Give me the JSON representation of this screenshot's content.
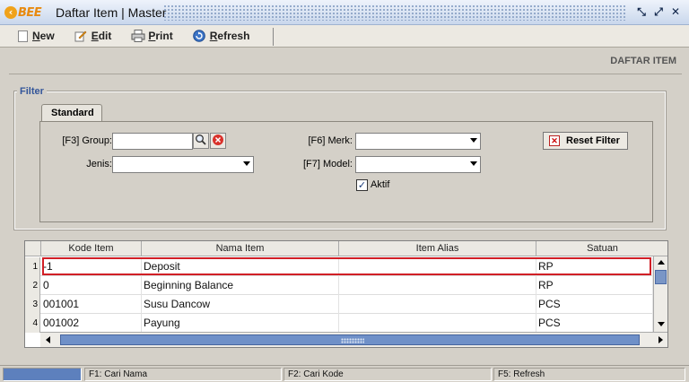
{
  "window": {
    "logo_text": "BEE",
    "title": "Daftar Item | Master"
  },
  "toolbar": {
    "new_label": "New",
    "edit_label": "Edit",
    "print_label": "Print",
    "refresh_label": "Refresh"
  },
  "page": {
    "section_title": "DAFTAR ITEM"
  },
  "filter": {
    "legend": "Filter",
    "tab_label": "Standard",
    "group_label": "[F3] Group:",
    "jenis_label": "Jenis:",
    "merk_label": "[F6] Merk:",
    "model_label": "[F7] Model:",
    "aktif_label": "Aktif",
    "aktif_checked": true,
    "reset_label": "Reset Filter",
    "group_value": "",
    "jenis_value": "",
    "merk_value": "",
    "model_value": ""
  },
  "grid": {
    "columns": [
      "Kode Item",
      "Nama Item",
      "Item Alias",
      "Satuan"
    ],
    "rows": [
      {
        "num": "1",
        "kode": "-1",
        "nama": "Deposit",
        "alias": "",
        "satuan": "RP"
      },
      {
        "num": "2",
        "kode": "0",
        "nama": "Beginning Balance",
        "alias": "",
        "satuan": "RP"
      },
      {
        "num": "3",
        "kode": "001001",
        "nama": "Susu Dancow",
        "alias": "",
        "satuan": "PCS"
      },
      {
        "num": "4",
        "kode": "001002",
        "nama": "Payung",
        "alias": "",
        "satuan": "PCS"
      }
    ]
  },
  "statusbar": {
    "f1": "F1: Cari Nama",
    "f2": "F2: Cari Kode",
    "f5": "F5: Refresh"
  },
  "colors": {
    "selection_border": "#d11f26",
    "accent": "#5d80bd"
  }
}
